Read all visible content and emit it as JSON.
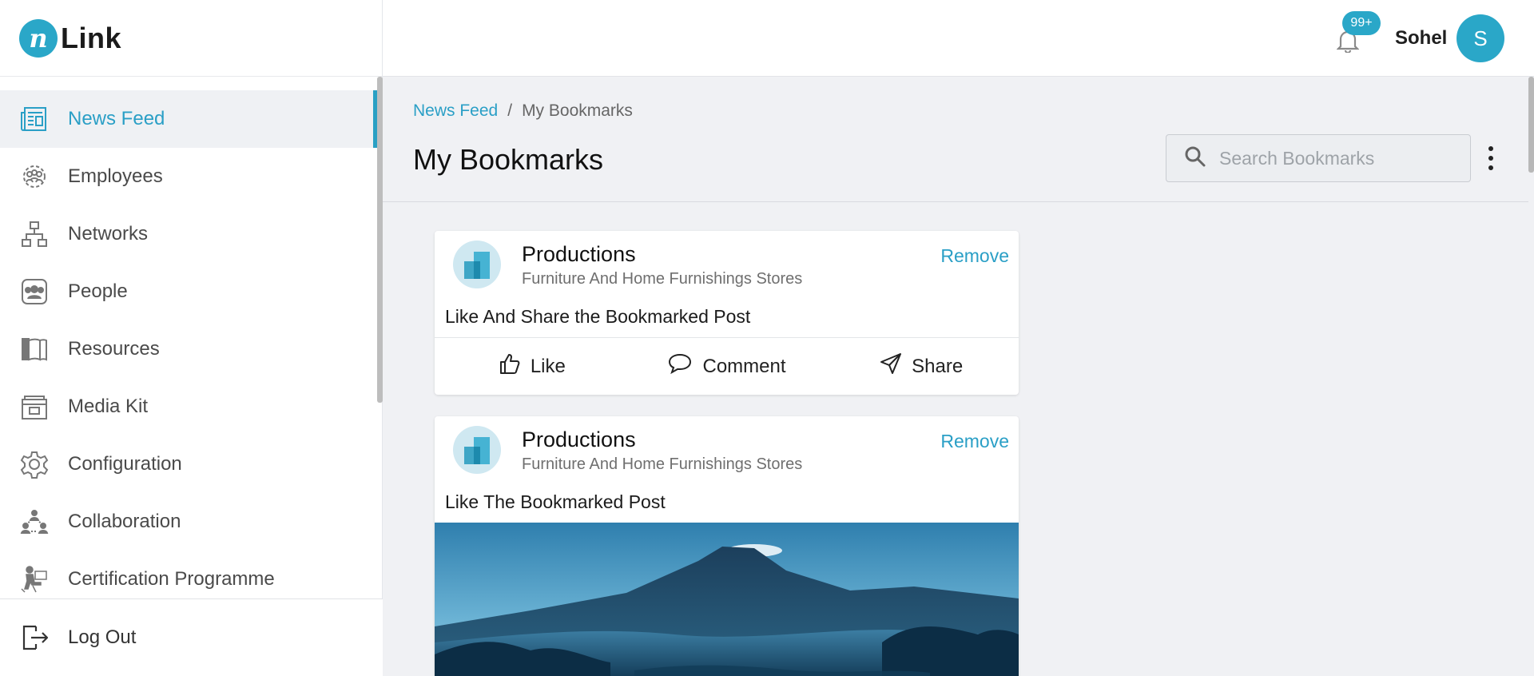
{
  "app": {
    "logo_text": "Link",
    "logo_mark": "n"
  },
  "sidebar": {
    "items": [
      {
        "label": "News Feed",
        "icon": "newspaper-icon",
        "active": true
      },
      {
        "label": "Employees",
        "icon": "employees-icon"
      },
      {
        "label": "Networks",
        "icon": "network-icon"
      },
      {
        "label": "People",
        "icon": "people-icon"
      },
      {
        "label": "Resources",
        "icon": "book-icon"
      },
      {
        "label": "Media Kit",
        "icon": "media-kit-icon"
      },
      {
        "label": "Configuration",
        "icon": "gear-icon"
      },
      {
        "label": "Collaboration",
        "icon": "collaboration-icon"
      },
      {
        "label": "Certification Programme",
        "icon": "certification-icon"
      }
    ],
    "logout_label": "Log Out"
  },
  "topbar": {
    "notification_badge": "99+",
    "username": "Sohel",
    "avatar_initial": "S"
  },
  "breadcrumb": {
    "root": "News Feed",
    "separator": "/",
    "current": "My Bookmarks"
  },
  "page": {
    "title": "My Bookmarks",
    "search_placeholder": "Search Bookmarks"
  },
  "posts": [
    {
      "org_name": "Productions",
      "org_category": "Furniture And Home Furnishings Stores",
      "remove_label": "Remove",
      "text": "Like And Share the Bookmarked Post",
      "actions": {
        "like": "Like",
        "comment": "Comment",
        "share": "Share"
      }
    },
    {
      "org_name": "Productions",
      "org_category": "Furniture And Home Furnishings Stores",
      "remove_label": "Remove",
      "text": "Like The Bookmarked Post",
      "image": "mountain-landscape"
    }
  ],
  "colors": {
    "accent": "#2aa7c8",
    "link": "#2a9fc6",
    "background": "#f0f1f4"
  }
}
